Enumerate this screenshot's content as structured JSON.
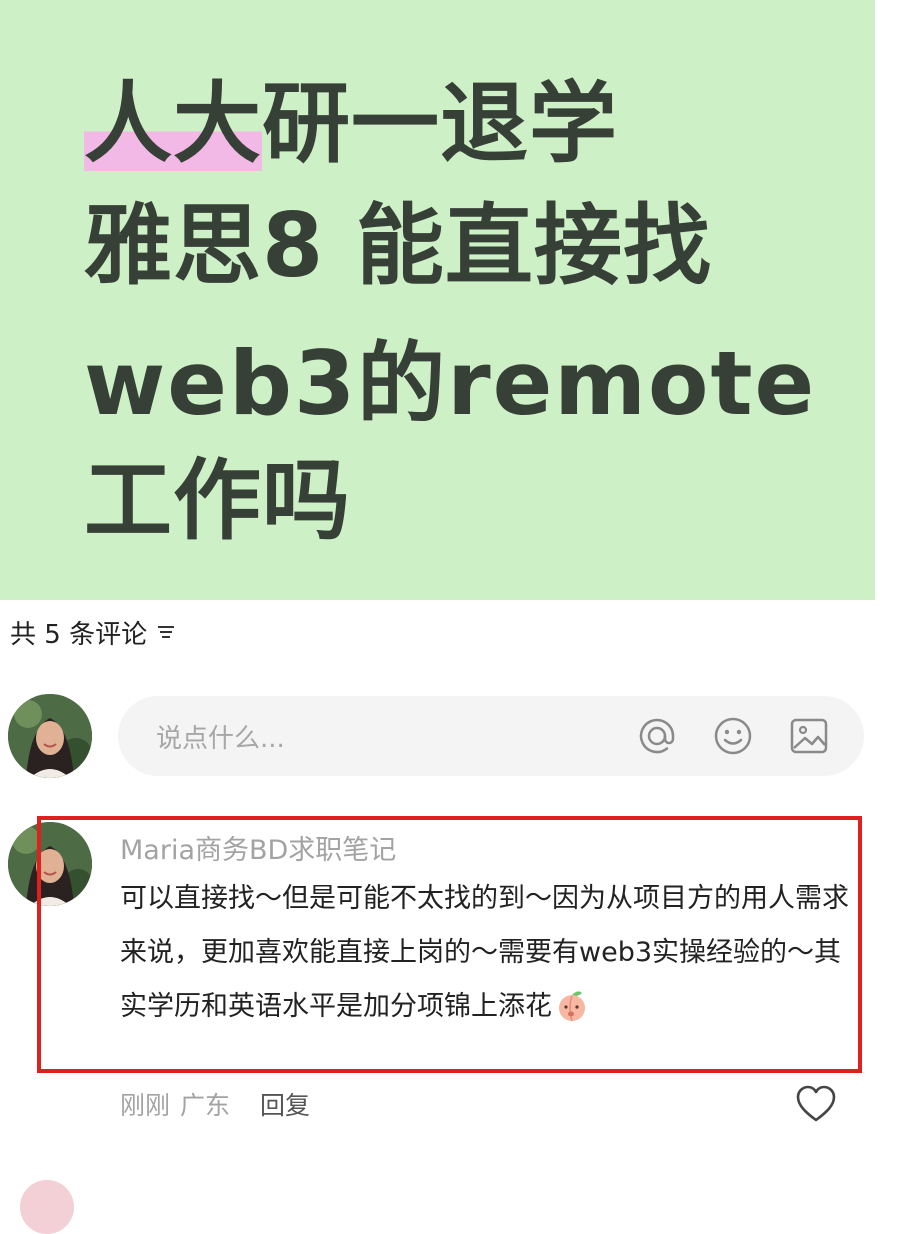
{
  "cover": {
    "line1_highlight": "人大",
    "line1_rest": "研一退学",
    "line2": "雅思8 能直接找",
    "line3": "web3的remote",
    "line4": "工作吗",
    "background": "#cdf0c6",
    "highlight_color": "#f2b8e6"
  },
  "comments_header": {
    "label": "共 5 条评论",
    "icon": "filter-icon"
  },
  "input": {
    "placeholder": "说点什么...",
    "icons": [
      "at-icon",
      "emoji-icon",
      "image-icon"
    ]
  },
  "comment": {
    "author": "Maria商务BD求职笔记",
    "text": "可以直接找～但是可能不太找的到～因为从项目方的用人需求来说，更加喜欢能直接上岗的～需要有web3实操经验的～其实学历和英语水平是加分项锦上添花",
    "emoji": "peach-emoji",
    "time": "刚刚",
    "location": "广东",
    "reply_label": "回复",
    "highlight_border_color": "#e01f1f"
  }
}
